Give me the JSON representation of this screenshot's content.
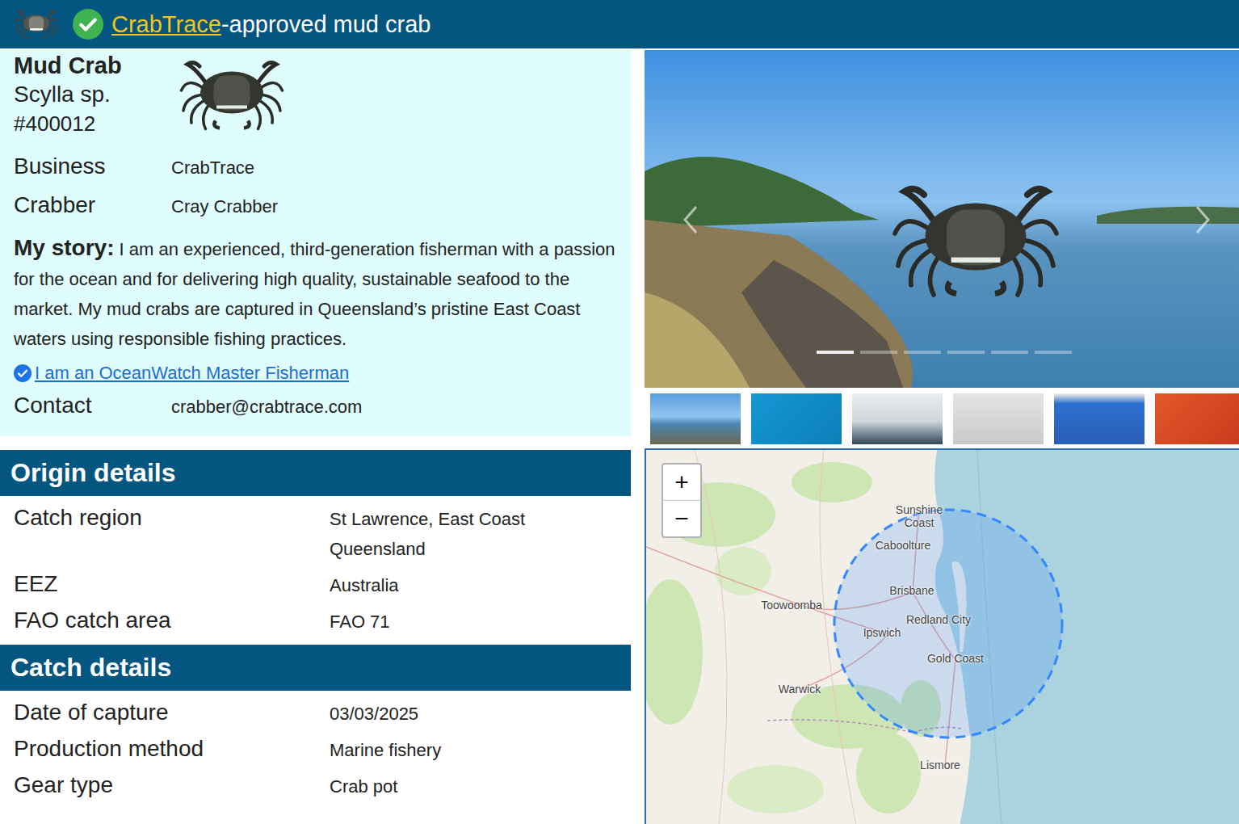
{
  "header": {
    "brand": "CrabTrace",
    "suffix": "-approved mud crab"
  },
  "product": {
    "name": "Mud Crab",
    "species": "Scylla sp.",
    "id": "#400012"
  },
  "fields": [
    {
      "label": "Business",
      "value": "CrabTrace"
    },
    {
      "label": "Crabber",
      "value": "Cray Crabber"
    }
  ],
  "story": {
    "label": "My story:",
    "text": "I am an experienced, third-generation fisherman with a passion for the ocean and for delivering high quality, sustainable seafood to the market. My mud crabs are captured in Queensland’s pristine East Coast waters using responsible fishing practices."
  },
  "certification": {
    "text": "I am an OceanWatch Master Fisherman"
  },
  "contact": {
    "label": "Contact",
    "value": "crabber@crabtrace.com"
  },
  "origin": {
    "title": "Origin details",
    "rows": [
      {
        "label": "Catch region",
        "value": "St Lawrence, East Coast Queensland"
      },
      {
        "label": "EEZ",
        "value": "Australia"
      },
      {
        "label": "FAO catch area",
        "value": "FAO 71"
      }
    ]
  },
  "catch": {
    "title": "Catch details",
    "rows": [
      {
        "label": "Date of capture",
        "value": "03/03/2025"
      },
      {
        "label": "Production method",
        "value": "Marine fishery"
      },
      {
        "label": "Gear type",
        "value": "Crab pot"
      }
    ]
  },
  "gallery": {
    "items": [
      {
        "selected": true
      },
      {
        "selected": false
      },
      {
        "selected": false
      },
      {
        "selected": false
      },
      {
        "selected": false
      },
      {
        "selected": false
      }
    ]
  },
  "map": {
    "zoom_in": "+",
    "zoom_out": "−",
    "places": [
      "Sunshine Coast",
      "Caboolture",
      "Toowoomba",
      "Brisbane",
      "Redland City",
      "Ipswich",
      "Gold Coast",
      "Warwick",
      "Lismore"
    ]
  }
}
